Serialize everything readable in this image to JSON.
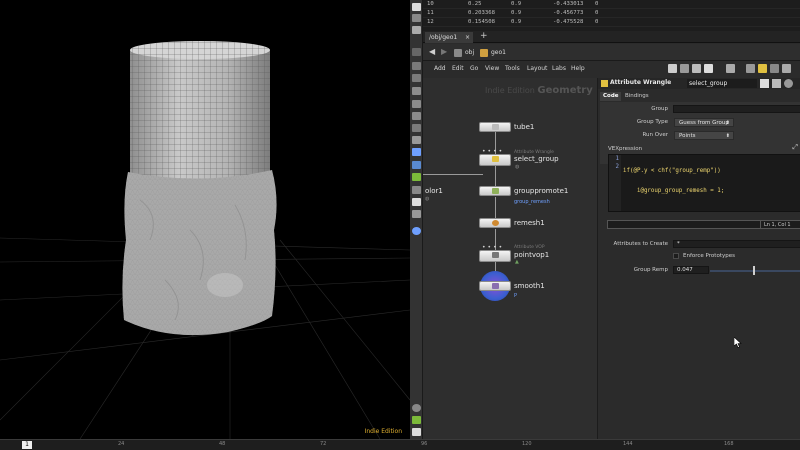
{
  "viewport": {
    "badge": "Indie Edition"
  },
  "timeline": {
    "current_frame": "1",
    "ticks": [
      "24",
      "48",
      "72",
      "96",
      "120",
      "144",
      "168"
    ]
  },
  "spreadsheet": {
    "rows": [
      {
        "index": "10",
        "c1": "0.25",
        "c2": "0.9",
        "c3": "-0.433013",
        "c4": "0"
      },
      {
        "index": "11",
        "c1": "0.203368",
        "c2": "0.9",
        "c3": "-0.456773",
        "c4": "0"
      },
      {
        "index": "12",
        "c1": "0.154508",
        "c2": "0.9",
        "c3": "-0.475528",
        "c4": "0"
      }
    ]
  },
  "tabs": {
    "active": "/obj/geo1",
    "add": "+"
  },
  "path": {
    "back": "◀",
    "forward": "▶",
    "segments": [
      "obj",
      "geo1"
    ]
  },
  "menu": {
    "items": [
      "Add",
      "Edit",
      "Go",
      "View",
      "Tools",
      "Layout",
      "Labs",
      "Help"
    ]
  },
  "network": {
    "watermark_left": "Indie Edition",
    "watermark_right": "Geometry",
    "nodes": [
      {
        "name": "tube1",
        "subtitle": "",
        "flag": ""
      },
      {
        "name": "select_group",
        "subtitle": "Attribute Wrangle",
        "flag": ""
      },
      {
        "name": "grouppromote1",
        "subtitle": "",
        "flag": "group_remesh"
      },
      {
        "name": "remesh1",
        "subtitle": "",
        "flag": ""
      },
      {
        "name": "pointvop1",
        "subtitle": "Attribute VOP",
        "flag": ""
      },
      {
        "name": "smooth1",
        "subtitle": "",
        "flag": "P"
      }
    ],
    "offscreen_node": "olor1"
  },
  "params": {
    "node_type": "Attribute Wrangle",
    "node_name": "select_group",
    "tabs": [
      "Code",
      "Bindings"
    ],
    "active_tab": "Code",
    "group_label": "Group",
    "group_value": "",
    "group_type_label": "Group Type",
    "group_type_value": "Guess from Group",
    "run_over_label": "Run Over",
    "run_over_value": "Points",
    "vex_label": "VEXpression",
    "code_lines": [
      "if(@P.y < chf(\"group_remp\"))",
      "    i@group_group_remesh = 1;"
    ],
    "line_numbers": [
      "1",
      "2"
    ],
    "status": "Ln 1, Col 1",
    "attrs_label": "Attributes to Create",
    "attrs_value": "*",
    "enforce_label": "Enforce Prototypes",
    "remp_label": "Group Remp",
    "remp_value": "0.047",
    "remp_fraction": 0.47
  },
  "colors": {
    "node_yellow": "#e0c040",
    "wire": "#9a9a9a",
    "smooth_purple": "#8a4fd6",
    "flag_blue": "#6fa0ff",
    "indie_gold": "#e0b030"
  }
}
